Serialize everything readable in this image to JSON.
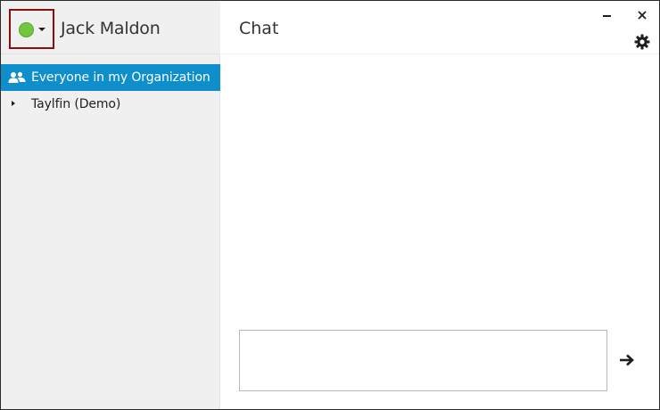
{
  "user": {
    "name": "Jack Maldon",
    "status_color": "#73c640",
    "status_icon": "status-dot-icon",
    "status_dropdown_icon": "caret-down-icon"
  },
  "contacts": {
    "group": {
      "label": "Everyone in my Organization",
      "icon": "group-users-icon",
      "selected": true,
      "highlight_color": "#0e8fcc"
    },
    "items": [
      {
        "label": "Taylfin (Demo)",
        "icon": "expand-arrow-icon",
        "expanded": false
      }
    ]
  },
  "chat": {
    "title": "Chat",
    "input_value": "",
    "input_placeholder": "",
    "send_icon": "arrow-right-icon"
  },
  "window_controls": {
    "minimize_icon": "minimize-icon",
    "close_icon": "close-icon",
    "settings_icon": "gear-icon"
  },
  "colors": {
    "sidebar_bg": "#f0f0f0",
    "accent": "#0e8fcc",
    "status_focus_border": "#8b0e12"
  }
}
